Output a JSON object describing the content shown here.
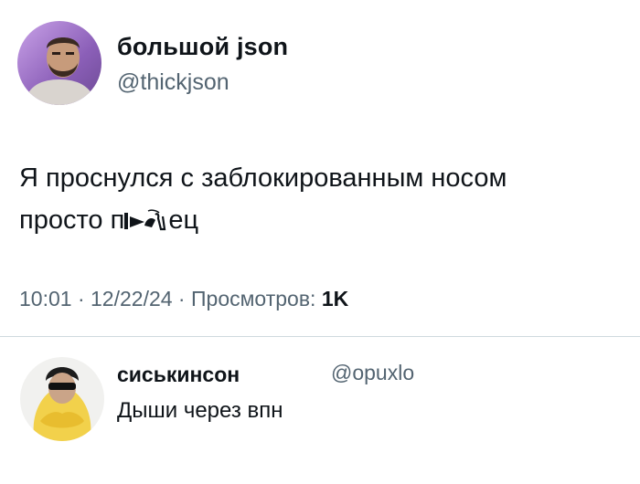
{
  "post": {
    "author": {
      "display_name": "большой json",
      "handle": "@thickjson"
    },
    "text_line_1": "Я проснулся с заблокированным носом",
    "text_line_2_before": "просто п",
    "text_line_2_after": "ец",
    "meta": {
      "time": "10:01",
      "sep_1": " · ",
      "date": "12/22/24",
      "sep_2": " · ",
      "views_label": "Просмотров: ",
      "views_count": "1K"
    }
  },
  "reply": {
    "display_name": "сиськинсон",
    "handle": "@opuxlo",
    "text": "Дыши через впн"
  },
  "colors": {
    "text_primary": "#0f1419",
    "text_secondary": "#536471",
    "divider": "#cfd9de",
    "background": "#ffffff"
  }
}
